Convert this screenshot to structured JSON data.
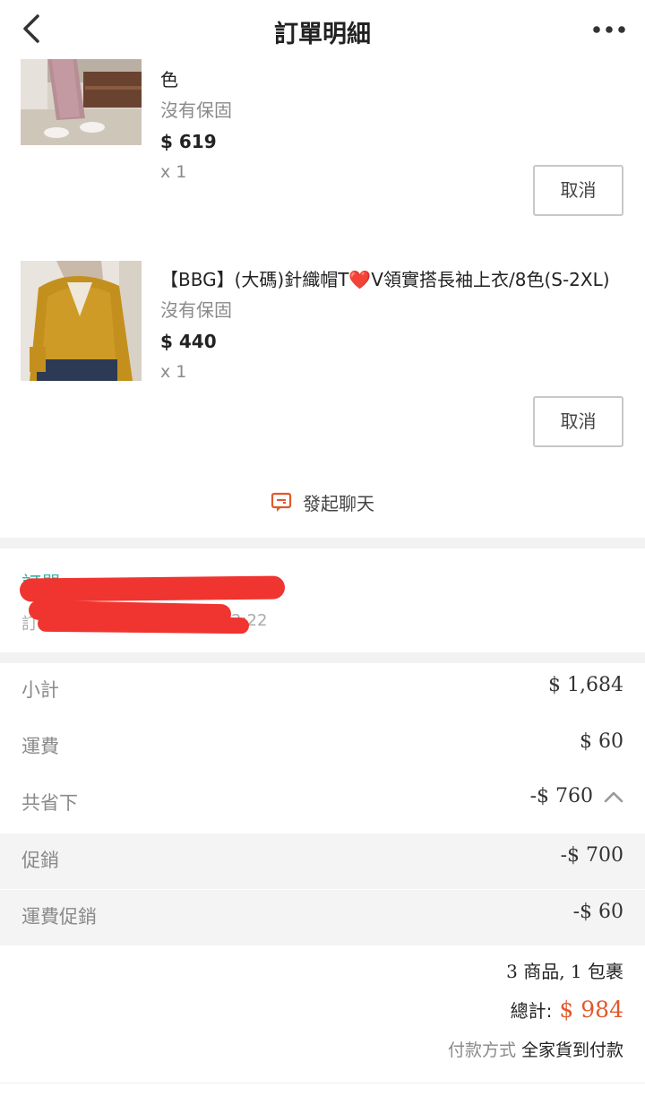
{
  "header": {
    "title": "訂單明細"
  },
  "products": [
    {
      "name": "色",
      "warranty": "沒有保固",
      "price": "$ 619",
      "qty": "x 1",
      "cancel_label": "取消"
    },
    {
      "name": "【BBG】(大碼)針織帽T❤️V領實搭長袖上衣/8色(S-2XL)",
      "warranty": "沒有保固",
      "price": "$ 440",
      "qty": "x 1",
      "cancel_label": "取消"
    }
  ],
  "chat": {
    "label": "發起聊天"
  },
  "order": {
    "number_partial": "訂單",
    "date_partial": "訂",
    "date_tail": "2:22"
  },
  "summary": {
    "subtotal": {
      "label": "小計",
      "value": "$ 1,684"
    },
    "shipping": {
      "label": "運費",
      "value": "$ 60"
    },
    "savings": {
      "label": "共省下",
      "value": "-$ 760"
    },
    "promo": {
      "label": "促銷",
      "value": "-$ 700"
    },
    "shipping_promo": {
      "label": "運費促銷",
      "value": "-$ 60"
    }
  },
  "totals": {
    "count": "3 商品, 1 包裹",
    "total_label": "總計:",
    "total_value": "$ 984",
    "payment_label": "付款方式",
    "payment_value": "全家貨到付款"
  },
  "colors": {
    "accent": "#e2592b",
    "teal": "#2bb5a8",
    "redaction": "#f0342f"
  }
}
